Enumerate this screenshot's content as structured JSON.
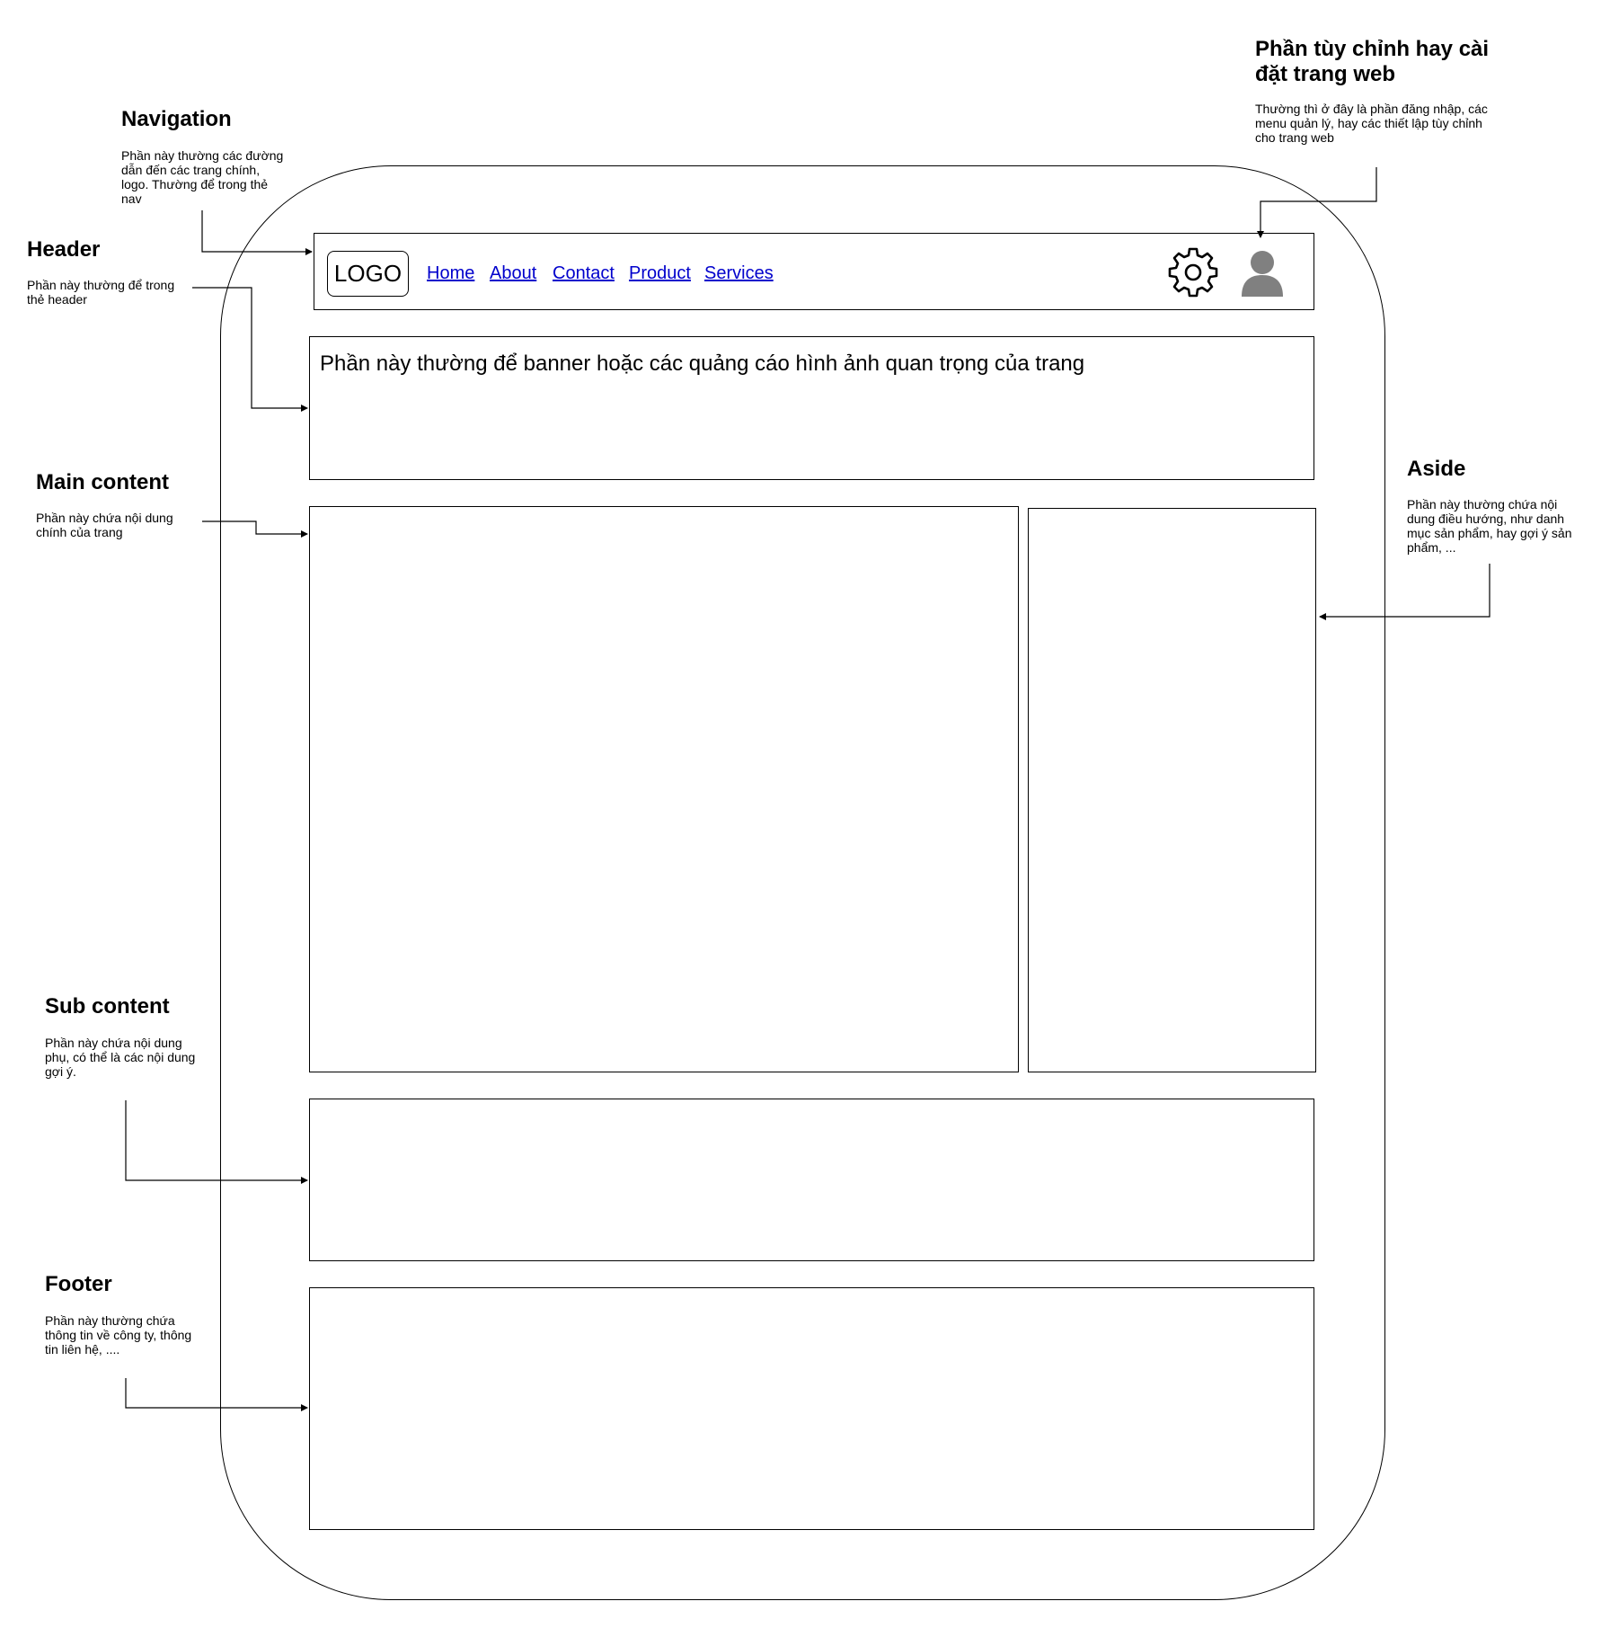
{
  "annotations": {
    "navigation": {
      "title": "Navigation",
      "desc": "Phần này thường các đường dẫn đến các trang chính, logo. Thường để trong thẻ nav"
    },
    "header": {
      "title": "Header",
      "desc": "Phần này thường để trong thẻ header"
    },
    "main": {
      "title": "Main content",
      "desc": "Phần này chứa nội dung chính của trang"
    },
    "sub": {
      "title": "Sub content",
      "desc": "Phần này chứa nội dung phụ, có thể là các nội dung gợi ý."
    },
    "footer": {
      "title": "Footer",
      "desc": "Phần này thường chứa thông tin về công ty, thông tin liên hệ, ...."
    },
    "settings": {
      "title": "Phần tùy chỉnh hay cài đặt trang web",
      "desc": "Thường thì ở đây là phần đăng nhập, các menu quản lý, hay các thiết lập tùy chỉnh cho trang web"
    },
    "aside": {
      "title": "Aside",
      "desc": "Phần này thường chứa nội dung điều hướng, như danh mục sản phẩm, hay gợi ý sản phẩm, ..."
    }
  },
  "nav": {
    "logo": "LOGO",
    "links": [
      "Home",
      "About",
      "Contact",
      "Product",
      "Services"
    ],
    "icons": [
      "gear-icon",
      "user-icon"
    ],
    "link_color": "#0000cc",
    "icon_color_gear": "#000000",
    "icon_color_user": "#808080"
  },
  "banner": {
    "text": "Phần này thường để banner hoặc các quảng cáo hình ảnh quan trọng của trang"
  }
}
